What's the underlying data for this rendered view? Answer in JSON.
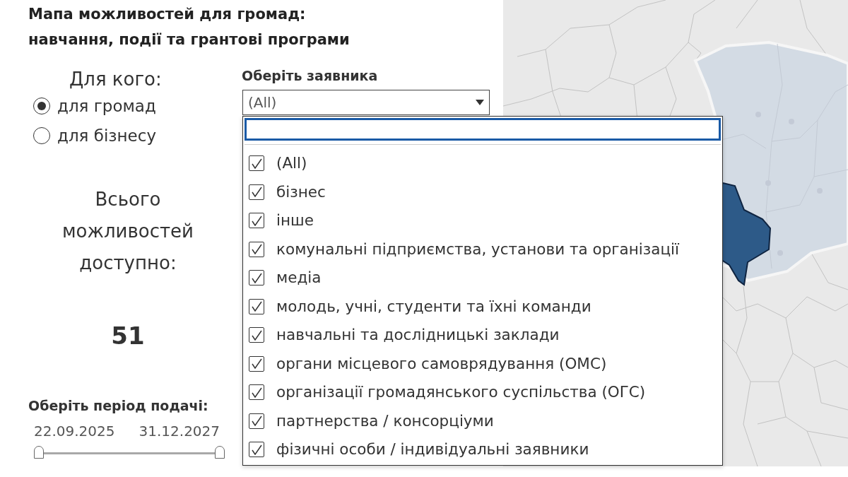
{
  "title": {
    "lines": [
      "Мапа можливостей для громад:",
      "навчання, події та грантові програми"
    ]
  },
  "audience": {
    "label": "Для кого:",
    "options": [
      {
        "label": "для громад",
        "selected": true
      },
      {
        "label": "для бізнесу",
        "selected": false
      }
    ]
  },
  "total": {
    "label": "Всього можливостей доступно:",
    "value": "51"
  },
  "period": {
    "label": "Оберіть період подачі:",
    "start": "22.09.2025",
    "end": "31.12.2027",
    "handles": [
      {
        "level": 0
      },
      {
        "level": 1
      }
    ]
  },
  "applicant_filter": {
    "label": "Оберіть заявника",
    "value": "(All)",
    "expanded": true,
    "options": [
      {
        "label": "(All)",
        "checked": true
      },
      {
        "label": "бізнес",
        "checked": true
      },
      {
        "label": "інше",
        "checked": true
      },
      {
        "label": "комунальні підприємства, установи та організації",
        "checked": true
      },
      {
        "label": "медіа",
        "checked": true
      },
      {
        "label": "молодь, учні, студенти та їхні команди",
        "checked": true
      },
      {
        "label": "навчальні та дослідницькі заклади",
        "checked": true
      },
      {
        "label": "органи місцевого самоврядування (ОМС)",
        "checked": true
      },
      {
        "label": "організації громадянського суспільства (ОГС)",
        "checked": true
      },
      {
        "label": "партнерства / консорціуми",
        "checked": true
      },
      {
        "label": "фізичні особи / індивідуальні заявники",
        "checked": true
      }
    ]
  }
}
